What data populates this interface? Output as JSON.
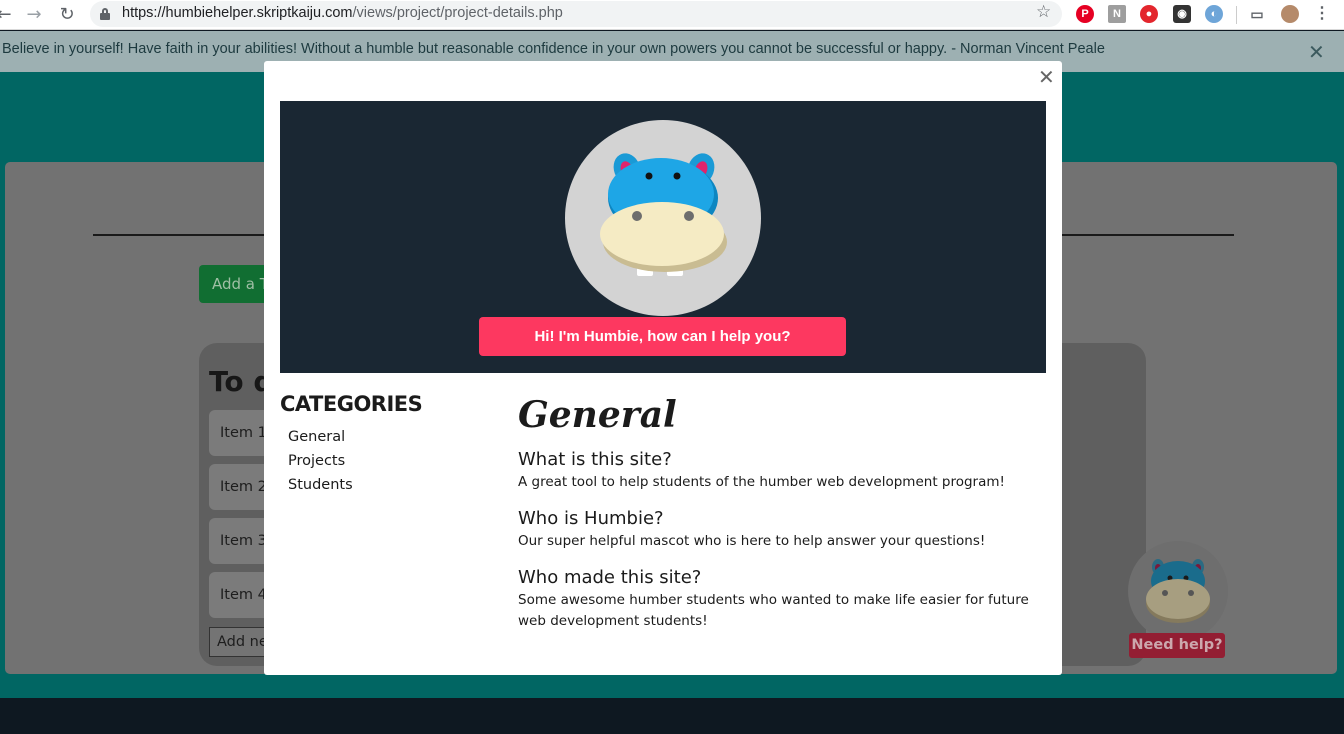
{
  "browser": {
    "url_main": "https://humbiehelper.skriptkaiju.com",
    "url_path": "/views/project/project-details.php"
  },
  "quote_bar": {
    "text": "Believe in yourself! Have faith in your abilities! Without a humble but reasonable confidence in your own powers you cannot be successful or happy. - Norman Vincent Peale"
  },
  "page": {
    "add_task_label": "Add a Ta",
    "todo_title": "To d",
    "items": [
      "Item 1",
      "Item 2",
      "Item 3",
      "Item 4"
    ],
    "add_new_placeholder": "Add ne",
    "help_label": "Need help?"
  },
  "modal": {
    "greeting": "Hi! I'm Humbie, how can I help you?",
    "categories_heading": "CATEGORIES",
    "categories": [
      "General",
      "Projects",
      "Students"
    ],
    "section_title": "General",
    "faqs": [
      {
        "q": "What is this site?",
        "a": "A great tool to help students of the humber web development program!"
      },
      {
        "q": "Who is Humbie?",
        "a": "Our super helpful mascot who is here to help answer your questions!"
      },
      {
        "q": "Who made this site?",
        "a": "Some awesome humber students who wanted to make life easier for future web development students!"
      }
    ]
  },
  "colors": {
    "teal": "#016663",
    "banner": "#1a2733",
    "greeting_button": "#fd3860",
    "help_label": "#931e33"
  }
}
